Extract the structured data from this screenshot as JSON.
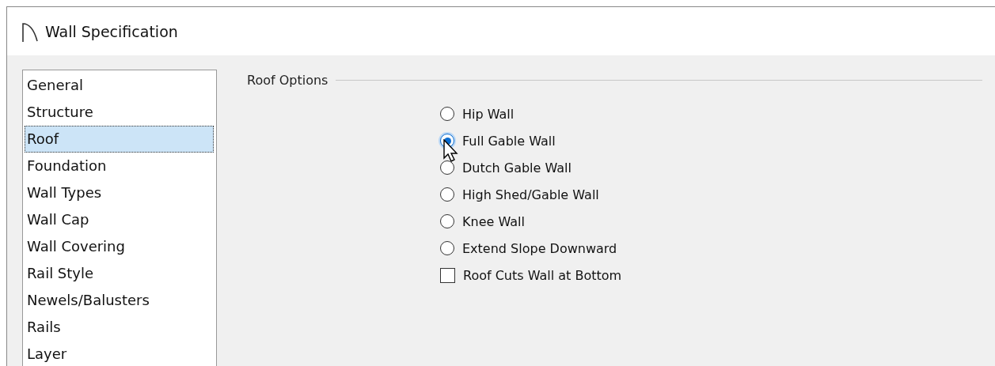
{
  "window": {
    "title": "Wall Specification"
  },
  "sidebar": {
    "items": [
      {
        "label": "General",
        "selected": false
      },
      {
        "label": "Structure",
        "selected": false
      },
      {
        "label": "Roof",
        "selected": true
      },
      {
        "label": "Foundation",
        "selected": false
      },
      {
        "label": "Wall Types",
        "selected": false
      },
      {
        "label": "Wall Cap",
        "selected": false
      },
      {
        "label": "Wall Covering",
        "selected": false
      },
      {
        "label": "Rail Style",
        "selected": false
      },
      {
        "label": "Newels/Balusters",
        "selected": false
      },
      {
        "label": "Rails",
        "selected": false
      },
      {
        "label": "Layer",
        "selected": false
      }
    ]
  },
  "roof_options": {
    "title": "Roof Options",
    "options": [
      {
        "kind": "radio",
        "label": "Hip Wall",
        "selected": false
      },
      {
        "kind": "radio",
        "label": "Full Gable Wall",
        "selected": true
      },
      {
        "kind": "radio",
        "label": "Dutch Gable Wall",
        "selected": false
      },
      {
        "kind": "radio",
        "label": "High Shed/Gable Wall",
        "selected": false
      },
      {
        "kind": "radio",
        "label": "Knee Wall",
        "selected": false
      },
      {
        "kind": "radio",
        "label": "Extend Slope Downward",
        "selected": false
      },
      {
        "kind": "checkbox",
        "label": "Roof Cuts Wall at Bottom",
        "checked": false
      }
    ]
  }
}
